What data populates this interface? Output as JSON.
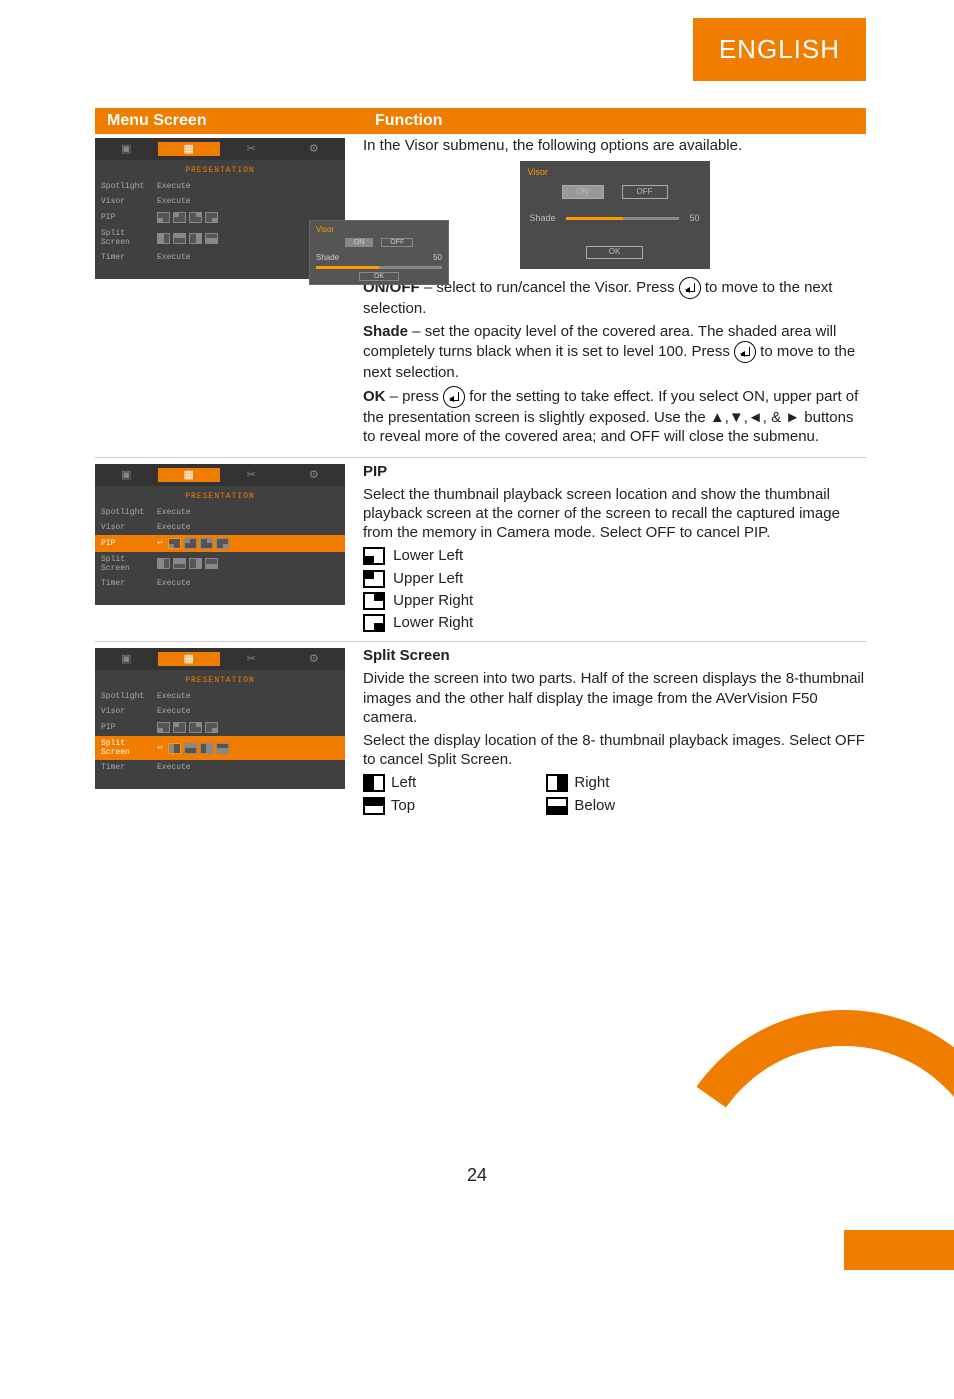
{
  "header": {
    "language": "ENGLISH"
  },
  "table_headers": {
    "menu": "Menu Screen",
    "func": "Function"
  },
  "arrows": "▲,▼,◄, & ►",
  "visor": {
    "intro": "In the Visor submenu, the following options are available.",
    "onoff_lead": "ON/OFF",
    "onoff_rest1": " – select to run/cancel the Visor. Press ",
    "onoff_rest2": " to move to the next selection.",
    "shade_lead": "Shade",
    "shade_rest1": " – set the opacity level of the covered area. The shaded area will completely turns black when it is set to level 100. Press ",
    "shade_rest2": " to move to the next selection.",
    "ok_lead": "OK",
    "ok_rest1": " – press ",
    "ok_rest2": " for the setting to take effect.  If you select ON, upper part of the presentation screen is slightly exposed. Use the ",
    "ok_rest3": " buttons to reveal more of the covered area; and OFF will close the submenu.",
    "submenu": {
      "title": "Visor",
      "on": "ON",
      "off": "OFF",
      "shade_label": "Shade",
      "shade_value": "50",
      "ok": "OK"
    }
  },
  "pip": {
    "title": "PIP",
    "desc": "Select the thumbnail playback screen location and show the thumbnail playback screen at the corner of the screen to recall the captured image from the memory in Camera mode. Select OFF to cancel PIP.",
    "lower_left": "Lower Left",
    "upper_left": "Upper Left",
    "upper_right": "Upper Right",
    "lower_right": "Lower Right"
  },
  "split": {
    "title": "Split Screen",
    "desc1": "Divide the screen into two parts. Half of the screen displays the 8-thumbnail images and the other half display the image from the AVerVision F50 camera.",
    "desc2": "Select the display location of the 8- thumbnail playback images. Select OFF to cancel Split Screen.",
    "left": "Left",
    "right": "Right",
    "top": "Top",
    "below": "Below"
  },
  "osd_menu": {
    "section": "PRESENTATION",
    "items": {
      "spotlight": "Spotlight",
      "visor": "Visor",
      "pip": "PIP",
      "split": "Split Screen",
      "timer": "Timer"
    },
    "execute": "Execute",
    "tab_icons": [
      "▣",
      "▦",
      "✂",
      "⚙"
    ]
  },
  "page_number": "24"
}
